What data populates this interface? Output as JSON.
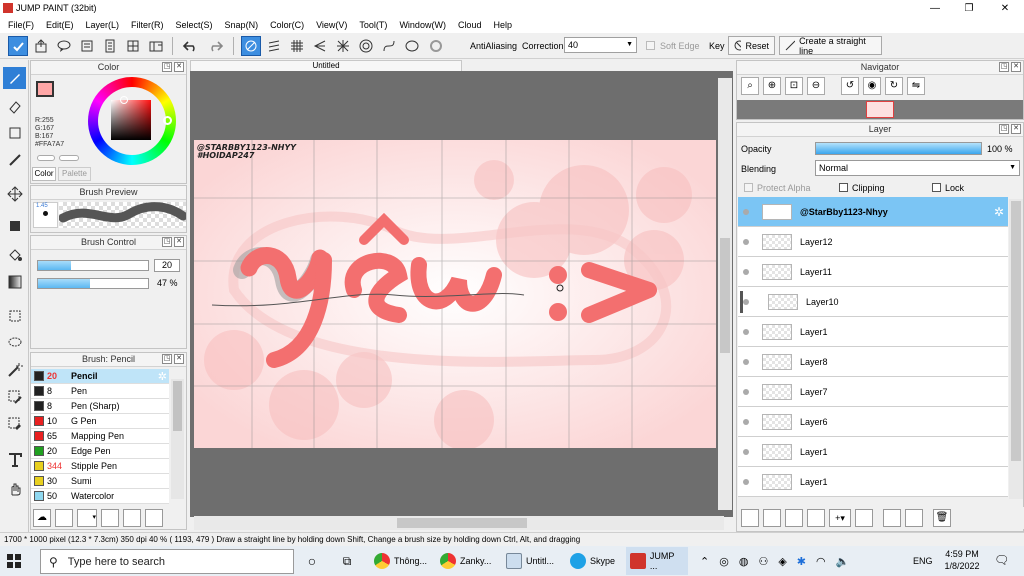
{
  "app": {
    "title": "JUMP PAINT (32bit)"
  },
  "window_controls": {
    "minimize": "—",
    "maximize": "❐",
    "close": "✕"
  },
  "menu": [
    "File(F)",
    "Edit(E)",
    "Layer(L)",
    "Filter(R)",
    "Select(S)",
    "Snap(N)",
    "Color(C)",
    "View(V)",
    "Tool(T)",
    "Window(W)",
    "Cloud",
    "Help"
  ],
  "toolbar": {
    "antialiasing_label": "AntiAliasing",
    "correction_label": "Correction",
    "correction_value": "40",
    "soft_edge_label": "Soft Edge",
    "key_label": "Key",
    "reset_label": "Reset",
    "straight_line_label": "Create a straight line"
  },
  "color_panel": {
    "title": "Color",
    "r": "R:255",
    "g": "G:167",
    "b": "B:167",
    "hex": "#FFA7A7",
    "tab_color": "Color",
    "tab_palette": "Palette",
    "current_color": "#ffa7a7"
  },
  "brush_preview": {
    "title": "Brush Preview",
    "size_label": "1.45"
  },
  "brush_control": {
    "title": "Brush Control",
    "size_value": "20",
    "opacity_value": "47 %",
    "size_fill": 0.3,
    "opacity_fill": 0.47
  },
  "brush_list": {
    "title": "Brush: Pencil",
    "items": [
      {
        "size": "20",
        "name": "Pencil",
        "color": "#222222",
        "selected": true
      },
      {
        "size": "8",
        "name": "Pen",
        "color": "#222222"
      },
      {
        "size": "8",
        "name": "Pen (Sharp)",
        "color": "#222222"
      },
      {
        "size": "10",
        "name": "G Pen",
        "color": "#e82020"
      },
      {
        "size": "65",
        "name": "Mapping Pen",
        "color": "#e82020"
      },
      {
        "size": "20",
        "name": "Edge Pen",
        "color": "#20a020"
      },
      {
        "size": "344",
        "name": "Stipple Pen",
        "color": "#e8d020"
      },
      {
        "size": "30",
        "name": "Sumi",
        "color": "#e8d020"
      },
      {
        "size": "50",
        "name": "Watercolor",
        "color": "#8fd8f0"
      }
    ]
  },
  "document": {
    "tab": "Untitled",
    "signature_line1": "@STARBBY1123-NHYY",
    "signature_line2": "#HOIDAP247",
    "artwork_text": "yêu :>"
  },
  "navigator": {
    "title": "Navigator"
  },
  "layer_panel": {
    "title": "Layer",
    "opacity_label": "Opacity",
    "opacity_value": "100 %",
    "opacity_fill": 1.0,
    "blending_label": "Blending",
    "blending_value": "Normal",
    "protect_alpha": "Protect Alpha",
    "clipping": "Clipping",
    "lock": "Lock",
    "layers": [
      {
        "name": "@StarBby1123-Nhyy",
        "selected": true
      },
      {
        "name": "Layer12"
      },
      {
        "name": "Layer11"
      },
      {
        "name": "Layer10",
        "indent": true
      },
      {
        "name": "Layer1"
      },
      {
        "name": "Layer8"
      },
      {
        "name": "Layer7"
      },
      {
        "name": "Layer6"
      },
      {
        "name": "Layer1"
      },
      {
        "name": "Layer1"
      }
    ]
  },
  "status": {
    "text": "1700 * 1000 pixel  (12.3 * 7.3cm)  350 dpi  40 %  ( 1193, 479 )   Draw a straight line by holding down Shift, Change a brush size by holding down Ctrl, Alt, and dragging"
  },
  "taskbar": {
    "search_placeholder": "Type here to search",
    "apps": [
      "Thông...",
      "Zanky...",
      "Untitl...",
      "Skype",
      "JUMP ..."
    ],
    "lang": "ENG",
    "time": "4:59 PM",
    "date": "1/8/2022"
  }
}
